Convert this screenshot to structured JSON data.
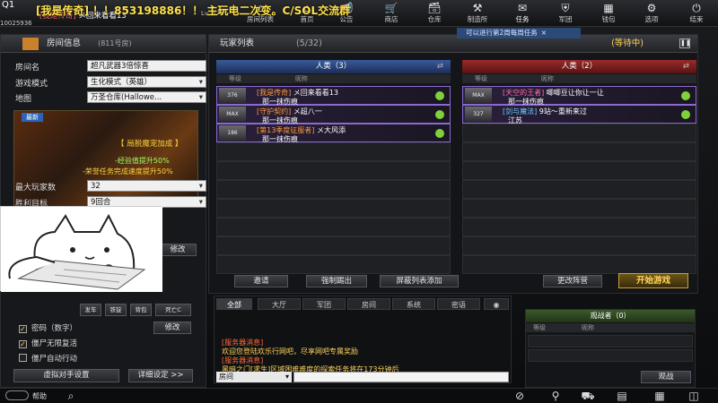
{
  "stream": {
    "banner": "[我是传奇] ！！853198886！！ 主玩电二次变。C/SOL交流群",
    "logo": "Q1"
  },
  "account": {
    "id": "10025936"
  },
  "player": {
    "tag": "[我是传奇]",
    "name": "メ回来看看13",
    "level": "Lv. 376"
  },
  "topnav": [
    {
      "label": "房间列表",
      "icon": "⌂"
    },
    {
      "label": "首页",
      "icon": "⌂"
    },
    {
      "label": "公告",
      "icon": "📢"
    },
    {
      "label": "商店",
      "icon": "🛒"
    },
    {
      "label": "仓库",
      "icon": "🗃"
    },
    {
      "label": "制造所",
      "icon": "⚒"
    },
    {
      "label": "任务",
      "icon": "✉"
    },
    {
      "label": "军团",
      "icon": "⛨"
    },
    {
      "label": "钱包",
      "icon": "▦"
    },
    {
      "label": "选项",
      "icon": "⚙"
    },
    {
      "label": "结束",
      "icon": "⏻"
    }
  ],
  "room": {
    "header": "房间信息",
    "room_no": "(811号房)",
    "name_label": "房间名",
    "name": "超凡武器3倍惊喜",
    "mode_label": "游戏模式",
    "mode": "生化模式（英雄）",
    "map_label": "地图",
    "map": "万圣仓库(Hallowe...",
    "banner_new": "最新",
    "banner_title": "【 局脱魔宠加成 】",
    "banner_line1": "-经验值提升50%",
    "banner_line2": "-荣誉任务完成速度提升50%",
    "max_label": "最大玩家数",
    "max": "32",
    "win_label": "胜利目标",
    "win": "9回合",
    "edit": "修改",
    "edit2": "修改",
    "chk1": "密码（数字）",
    "chk2": "僵尸无限复活",
    "chk3": "僵尸自动行动",
    "ai_btn": "虚拟对手设置",
    "detail_btn": "详细设定 >>",
    "weapons": [
      "发车",
      "铁锭",
      "背包",
      "死亡C"
    ]
  },
  "list": {
    "header": "玩家列表",
    "count": "(5/32)",
    "status": "(等待中)",
    "notice": "可以进行第2周每周任务",
    "team1": "人类（3）",
    "team2": "人类（2）",
    "col_lv": "等级",
    "col_name": "昵称",
    "left": [
      {
        "badge": "376",
        "title": "[我是传奇]",
        "name": "メ回来看看13",
        "clan": "那一抹伤痕",
        "style": "title"
      },
      {
        "badge": "MAX",
        "title": "[守护契约]",
        "name": "メ超八一",
        "clan": "那一抹伤痕",
        "style": "title"
      },
      {
        "badge": "186",
        "title": "[第13季度征服者]",
        "name": "メ大风添",
        "clan": "那一抹伤痕",
        "style": "title"
      }
    ],
    "right": [
      {
        "badge": "MAX",
        "title": "[天空的王者]",
        "name": "唧唧豆让你让一让",
        "clan": "那一抹伤痕",
        "style": "title pink"
      },
      {
        "badge": "327",
        "title": "[剑与魔法]",
        "name": "9站〜重新来过",
        "clan": "江苏",
        "style": "title cyan"
      }
    ],
    "btn_invite": "邀请",
    "btn_kick": "强制踢出",
    "btn_block": "屏蔽列表添加",
    "btn_team": "更改阵营",
    "btn_start": "开始游戏"
  },
  "chat": {
    "tabs": [
      "全部",
      "大厅",
      "军团",
      "房间",
      "系统",
      "密语"
    ],
    "lines": [
      "[服务器消息]",
      "欢迎您登陆欢乐行网吧，尽享网吧专属奖励",
      "[服务器消息]",
      "黑暗之门[求生]区域困难难度的探索任务将在173分钟后"
    ],
    "channel": "房间"
  },
  "observers": {
    "header": "观战者（0）",
    "col_lv": "等级",
    "col_name": "昵称",
    "btn": "观战"
  },
  "bottom": {
    "help": "帮助"
  }
}
